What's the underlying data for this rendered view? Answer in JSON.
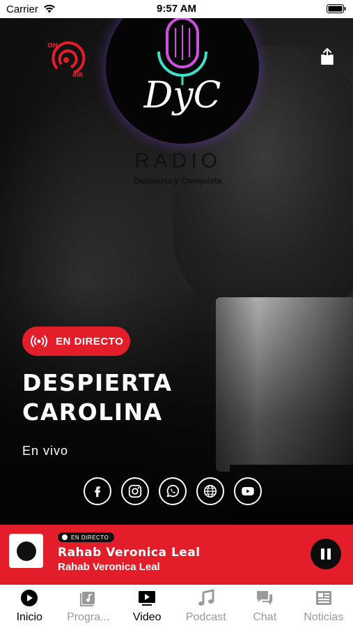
{
  "status_bar": {
    "carrier": "Carrier",
    "time": "9:57 AM"
  },
  "logo": {
    "radio_text": "RADIO",
    "tagline": "Despierta y Conquista",
    "monogram": "DyC",
    "onair_on": "ON",
    "onair_air": "AIR"
  },
  "hero": {
    "live_badge": "EN DIRECTO",
    "title": "DESPIERTA CAROLINA",
    "subtitle": "En vivo",
    "social": [
      "facebook-icon",
      "instagram-icon",
      "whatsapp-icon",
      "globe-icon",
      "youtube-icon"
    ]
  },
  "player": {
    "badge": "EN DIRECTO",
    "title": "Rahab Veronica Leal",
    "artist": "Rahab Veronica Leal"
  },
  "tabs": [
    {
      "label": "Inicio",
      "icon": "play-circle-icon",
      "active": true
    },
    {
      "label": "Progra...",
      "icon": "music-library-icon",
      "active": false
    },
    {
      "label": "Video",
      "icon": "video-icon",
      "active": true
    },
    {
      "label": "Podcast",
      "icon": "music-note-icon",
      "active": false
    },
    {
      "label": "Chat",
      "icon": "chat-icon",
      "active": false
    },
    {
      "label": "Noticias",
      "icon": "newspaper-icon",
      "active": false
    }
  ],
  "colors": {
    "accent": "#e41d2b",
    "dark": "#0c0c0c",
    "inactive": "#9a9a9a"
  }
}
